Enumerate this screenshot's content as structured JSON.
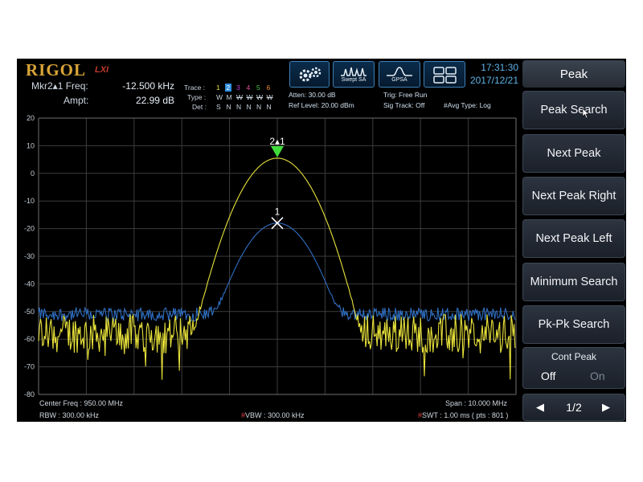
{
  "header": {
    "brand": "RIGOL",
    "brand_sub": "LXI",
    "marker_label": "Mkr2▴1 Freq:",
    "marker_value": "-12.500 kHz",
    "ampt_label": "Ampt:",
    "ampt_value": "22.99 dB",
    "trace_label": "Trace :",
    "trace_numbers": [
      "1",
      "2",
      "3",
      "4",
      "5",
      "6"
    ],
    "trace_colors": [
      "#e8e23a",
      "#2f8fe0",
      "#c23fd6",
      "#e0509a",
      "#4fc24f",
      "#e88b3a"
    ],
    "type_label": "Type :",
    "type_values": [
      "W",
      "M",
      "W",
      "W",
      "W",
      "W"
    ],
    "det_label": "Det :",
    "det_values": [
      "S",
      "N",
      "N",
      "N",
      "N",
      "N"
    ],
    "atten": "Atten: 30.00 dB",
    "ref_level": "Ref Level: 20.00 dBm",
    "trig": "Trig: Free Run",
    "sig_track": "Sig Track: Off",
    "avg_type": "#Avg Type: Log",
    "mode1_label": "Swept SA",
    "mode2_label": "GPSA",
    "time": "17:31:30",
    "date": "2017/12/21"
  },
  "plot": {
    "y_ticks": [
      "20",
      "10",
      "0",
      "-10",
      "-20",
      "-30",
      "-40",
      "-50",
      "-60",
      "-70",
      "-80"
    ],
    "marker_ref_label": "2▴1",
    "marker1_label": "1"
  },
  "footer": {
    "center_freq": "Center Freq : 950.00 MHz",
    "span": "Span : 10.000 MHz",
    "rbw": "RBW : 300.00 kHz",
    "vbw_hash": "#",
    "vbw": "VBW : 300.00 kHz",
    "swt_hash": "#",
    "swt": "SWT : 1.00 ms ( pts : 801 )"
  },
  "menu": {
    "title": "Peak",
    "items": [
      "Peak Search",
      "Next Peak",
      "Next Peak Right",
      "Next Peak Left",
      "Minimum Search",
      "Pk-Pk Search"
    ],
    "cont_peak_label": "Cont Peak",
    "cont_peak_off": "Off",
    "cont_peak_on": "On",
    "page": "1/2",
    "page_prev": "◀",
    "page_next": "▶"
  },
  "colors": {
    "trace1": "#e8e23a",
    "trace2": "#2f6fc2",
    "marker_green": "#3fdc3a",
    "accent_blue": "#5fb3e8"
  }
}
